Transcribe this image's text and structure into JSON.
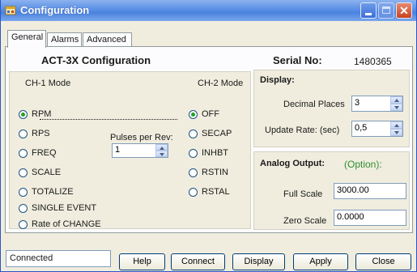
{
  "window": {
    "title": "Configuration"
  },
  "tabs": [
    {
      "label": "General",
      "active": true
    },
    {
      "label": "Alarms",
      "active": false
    },
    {
      "label": "Advanced",
      "active": false
    }
  ],
  "general": {
    "heading": "ACT-3X Configuration",
    "serial_label": "Serial No:",
    "serial_value": "1480365",
    "ch1_mode_label": "CH-1 Mode",
    "ch2_mode_label": "CH-2 Mode",
    "ch1_options": [
      {
        "label": "RPM",
        "checked": true
      },
      {
        "label": "RPS",
        "checked": false
      },
      {
        "label": "FREQ",
        "checked": false
      },
      {
        "label": "SCALE",
        "checked": false
      },
      {
        "label": "TOTALIZE",
        "checked": false
      },
      {
        "label": "SINGLE EVENT",
        "checked": false
      },
      {
        "label": "Rate of CHANGE",
        "checked": false
      }
    ],
    "ch2_options": [
      {
        "label": "OFF",
        "checked": true
      },
      {
        "label": "SECAP",
        "checked": false
      },
      {
        "label": "INHBT",
        "checked": false
      },
      {
        "label": "RSTIN",
        "checked": false
      },
      {
        "label": "RSTAL",
        "checked": false
      }
    ],
    "pulses_label": "Pulses per Rev:",
    "pulses_value": "1"
  },
  "display": {
    "heading": "Display:",
    "decimal_label": "Decimal Places",
    "decimal_value": "3",
    "update_label": "Update Rate: (sec)",
    "update_value": "0,5"
  },
  "analog": {
    "heading": "Analog Output:",
    "option_text": "(Option):",
    "option_color": "#2f8f2f",
    "full_scale_label": "Full Scale",
    "full_scale_value": "3000.00",
    "zero_scale_label": "Zero Scale",
    "zero_scale_value": "0.0000"
  },
  "footer": {
    "status": "Connected",
    "buttons": {
      "help": "Help",
      "connect": "Connect",
      "display": "Display",
      "apply": "Apply",
      "close": "Close"
    }
  },
  "icons": {
    "app": "app-window-icon",
    "minimize": "minimize-icon",
    "maximize": "maximize-icon",
    "close": "close-icon"
  }
}
